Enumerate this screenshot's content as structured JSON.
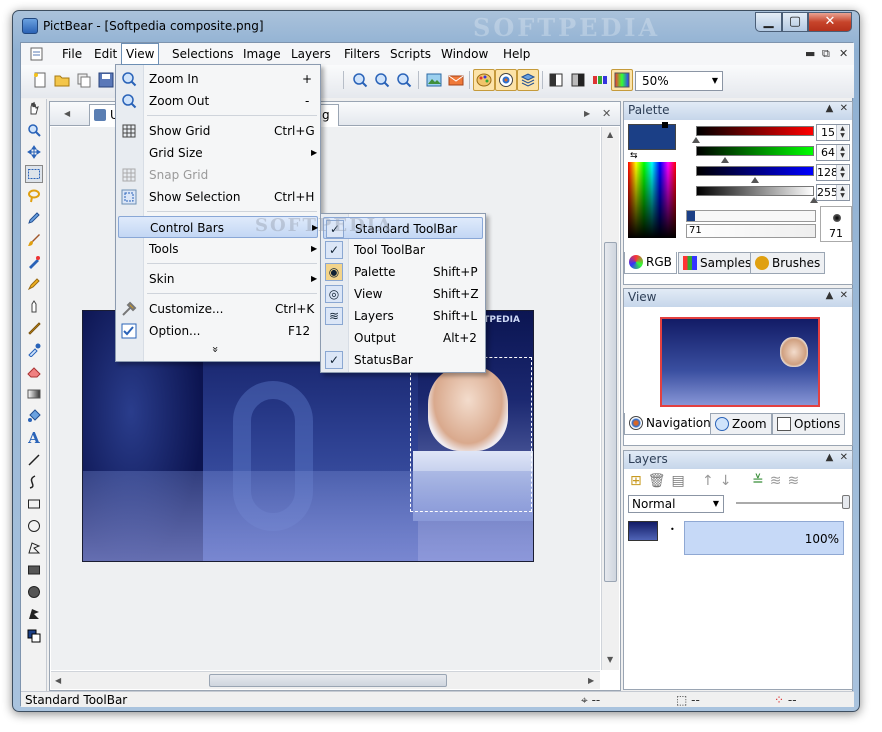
{
  "window": {
    "title": "PictBear - [Softpedia composite.png]",
    "watermark": "SOFTPEDIA"
  },
  "menubar": {
    "items": [
      "File",
      "Edit",
      "View",
      "Selections",
      "Image",
      "Layers",
      "Filters",
      "Scripts",
      "Window",
      "Help"
    ]
  },
  "toolbar": {
    "zoom": "50%"
  },
  "document": {
    "tab_label": "U",
    "tab_label_tail": "g",
    "image_caption": "SOFTPEDIA"
  },
  "view_menu": {
    "items": [
      {
        "label": "Zoom In",
        "shortcut": "+"
      },
      {
        "label": "Zoom Out",
        "shortcut": "-"
      },
      {
        "label": "Show Grid",
        "shortcut": "Ctrl+G"
      },
      {
        "label": "Grid Size",
        "shortcut": ""
      },
      {
        "label": "Snap Grid",
        "shortcut": ""
      },
      {
        "label": "Show Selection",
        "shortcut": "Ctrl+H"
      },
      {
        "label": "Control Bars",
        "shortcut": ""
      },
      {
        "label": "Tools",
        "shortcut": ""
      },
      {
        "label": "Skin",
        "shortcut": ""
      },
      {
        "label": "Customize...",
        "shortcut": "Ctrl+K"
      },
      {
        "label": "Option...",
        "shortcut": "F12"
      }
    ],
    "more": "»"
  },
  "control_bars_menu": {
    "items": [
      {
        "label": "Standard ToolBar",
        "shortcut": ""
      },
      {
        "label": "Tool ToolBar",
        "shortcut": ""
      },
      {
        "label": "Palette",
        "shortcut": "Shift+P"
      },
      {
        "label": "View",
        "shortcut": "Shift+Z"
      },
      {
        "label": "Layers",
        "shortcut": "Shift+L"
      },
      {
        "label": "Output",
        "shortcut": "Alt+2"
      },
      {
        "label": "StatusBar",
        "shortcut": ""
      }
    ]
  },
  "palette": {
    "title": "Palette",
    "fg_color": "#1b3f86",
    "values": [
      "15",
      "64",
      "128",
      "255"
    ],
    "brush_size": "71",
    "brush_value": "71",
    "tabs": [
      "RGB",
      "Samples",
      "Brushes"
    ]
  },
  "view_panel": {
    "title": "View",
    "tabs": [
      "Navigation",
      "Zoom",
      "Options"
    ]
  },
  "layers_panel": {
    "title": "Layers",
    "blend_mode": "Normal",
    "opacity": "100%"
  },
  "statusbar": {
    "text": "Standard ToolBar",
    "field1": "--",
    "field2": "--",
    "field3": "--"
  },
  "screen_watermark": "SOFTPEDIA"
}
